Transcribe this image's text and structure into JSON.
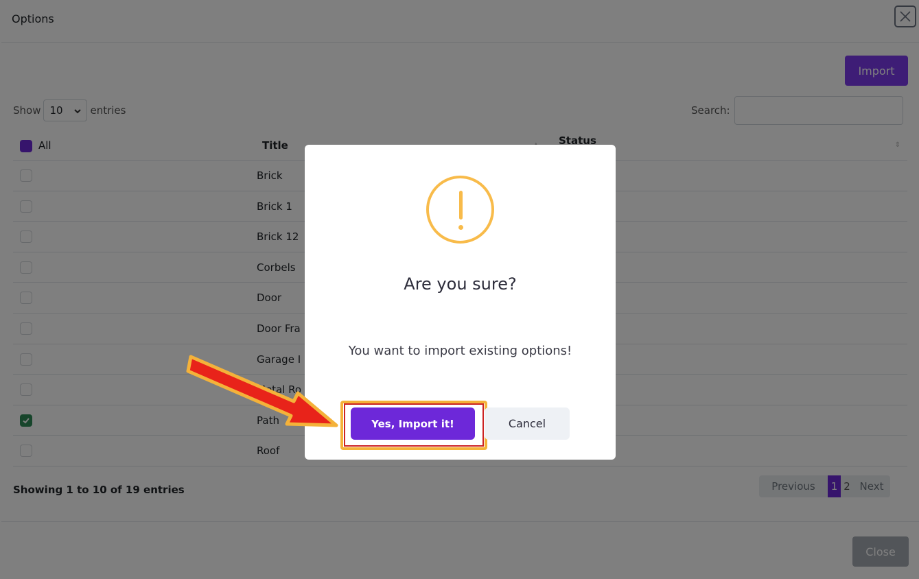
{
  "modal": {
    "title": "Options",
    "close_icon": "close-icon",
    "import_label": "Import",
    "length": {
      "show": "Show",
      "value": "10",
      "entries": "entries"
    },
    "search_label": "Search:",
    "search_value": "",
    "table": {
      "headers": {
        "all": "All",
        "title": "Title",
        "status": "Status"
      },
      "rows": [
        {
          "title": "Brick",
          "checked": false
        },
        {
          "title": "Brick 1",
          "checked": false
        },
        {
          "title": "Brick 12",
          "checked": false
        },
        {
          "title": "Corbels",
          "checked": false
        },
        {
          "title": "Door",
          "checked": false
        },
        {
          "title": "Door Fra",
          "checked": false
        },
        {
          "title": "Garage I",
          "checked": false
        },
        {
          "title": "Metal Ro",
          "checked": false
        },
        {
          "title": "Path",
          "checked": true
        },
        {
          "title": "Roof",
          "checked": false
        }
      ]
    },
    "info": "Showing 1 to 10 of 19 entries",
    "pagination": {
      "previous": "Previous",
      "page1": "1",
      "page2": "2",
      "next": "Next"
    },
    "close_label": "Close"
  },
  "dialog": {
    "icon": "warning-icon",
    "title": "Are you sure?",
    "text": "You want to import existing options!",
    "confirm_label": "Yes, Import it!",
    "cancel_label": "Cancel"
  },
  "colors": {
    "primary": "#6d28d9",
    "warning": "#f8bb4a",
    "success": "#2e8b57",
    "highlight": "#f4b23a",
    "arrow": "#e8231a"
  }
}
